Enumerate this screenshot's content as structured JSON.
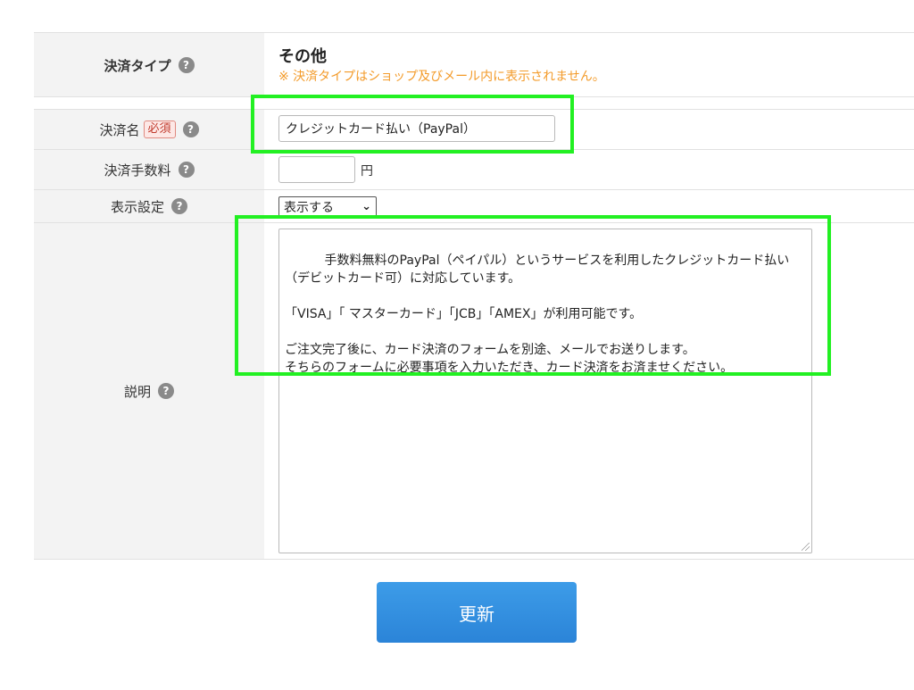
{
  "payment_type": {
    "label": "決済タイプ",
    "value": "その他",
    "note": "※ 決済タイプはショップ及びメール内に表示されません。"
  },
  "payment_name": {
    "label": "決済名",
    "required_badge": "必須",
    "value": "クレジットカード払い（PayPal）"
  },
  "payment_fee": {
    "label": "決済手数料",
    "value": "",
    "unit": "円"
  },
  "display_setting": {
    "label": "表示設定",
    "selected": "表示する"
  },
  "description": {
    "label": "説明",
    "value": "手数料無料のPayPal（ペイパル）というサービスを利用したクレジットカード払い（デビットカード可）に対応しています。\n\n「VISA」「 マスターカード」「JCB」「AMEX」が利用可能です。\n\nご注文完了後に、カード決済のフォームを別途、メールでお送りします。\nそちらのフォームに必要事項を入力いただき、カード決済をお済ませください。"
  },
  "help_icon_glyph": "?",
  "submit": {
    "label": "更新"
  },
  "colors": {
    "highlight": "#22f022",
    "note": "#f39b2a",
    "button": "#2b84d8"
  }
}
